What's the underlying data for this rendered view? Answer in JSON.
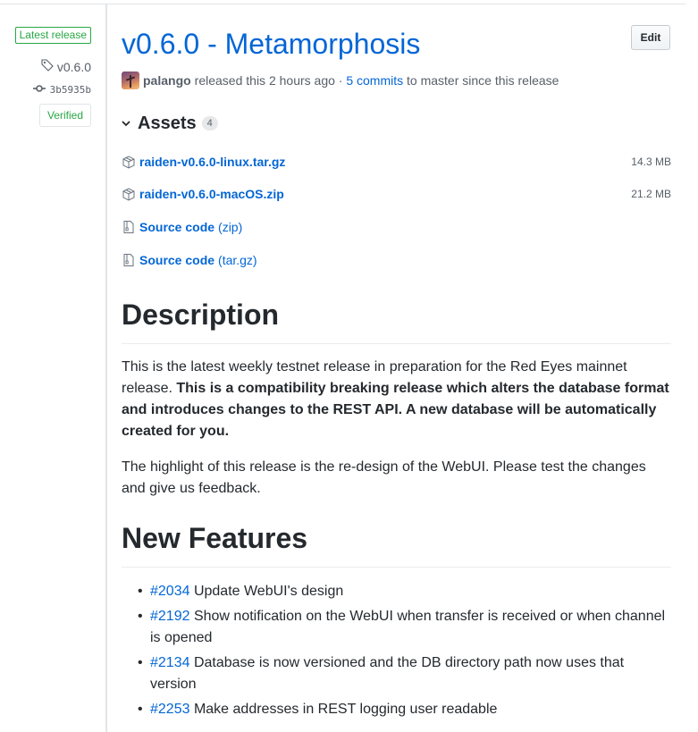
{
  "sidebar": {
    "latest_label": "Latest release",
    "tag": "v0.6.0",
    "commit": "3b5935b",
    "verified": "Verified"
  },
  "release": {
    "title": "v0.6.0 - Metamorphosis",
    "edit_label": "Edit",
    "author": "palango",
    "released_text": "released this 2 hours ago · ",
    "commits_link": "5 commits",
    "commits_suffix": " to master since this release"
  },
  "assets": {
    "title": "Assets",
    "count": "4",
    "items": [
      {
        "name": "raiden-v0.6.0-linux.tar.gz",
        "ext": "",
        "size": "14.3 MB",
        "icon": "package-icon"
      },
      {
        "name": "raiden-v0.6.0-macOS.zip",
        "ext": "",
        "size": "21.2 MB",
        "icon": "package-icon"
      },
      {
        "name": "Source code",
        "ext": "(zip)",
        "size": "",
        "icon": "file-zip-icon"
      },
      {
        "name": "Source code",
        "ext": "(tar.gz)",
        "size": "",
        "icon": "file-zip-icon"
      }
    ]
  },
  "description": {
    "heading": "Description",
    "p1_normal": "This is the latest weekly testnet release in preparation for the Red Eyes mainnet release. ",
    "p1_bold": "This is a compatibility breaking release which alters the database format and introduces changes to the REST API. A new database will be automatically created for you.",
    "p2": "The highlight of this release is the re-design of the WebUI. Please test the changes and give us feedback."
  },
  "features": {
    "heading": "New Features",
    "items": [
      {
        "issue": "#2034",
        "text": " Update WebUI's design"
      },
      {
        "issue": "#2192",
        "text": " Show notification on the WebUI when transfer is received or when channel is opened"
      },
      {
        "issue": "#2134",
        "text": " Database is now versioned and the DB directory path now uses that version"
      },
      {
        "issue": "#2253",
        "text": " Make addresses in REST logging user readable"
      }
    ]
  },
  "colors": {
    "link": "#0366d6",
    "verified": "#28a745",
    "text": "#24292e",
    "muted": "#586069"
  }
}
